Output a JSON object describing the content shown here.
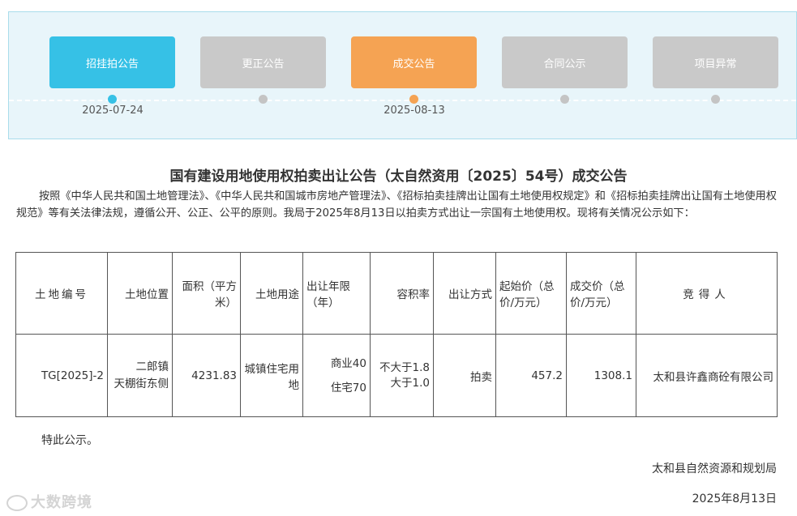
{
  "steps": [
    {
      "label": "招挂拍公告",
      "state": "done",
      "color": "#36c1e6",
      "date": "2025-07-24"
    },
    {
      "label": "更正公告",
      "state": "inactive",
      "color": "#c9c9c9",
      "date": ""
    },
    {
      "label": "成交公告",
      "state": "current",
      "color": "#f5a353",
      "date": "2025-08-13"
    },
    {
      "label": "合同公示",
      "state": "inactive",
      "color": "#c9c9c9",
      "date": ""
    },
    {
      "label": "项目异常",
      "state": "inactive",
      "color": "#c9c9c9",
      "date": ""
    }
  ],
  "title": "国有建设用地使用权拍卖出让公告（太自然资用〔2025〕54号）成交公告",
  "intro": "按照《中华人民共和国土地管理法》、《中华人民共和国城市房地产管理法》、《招标拍卖挂牌出让国有土地使用权规定》和《招标拍卖挂牌出让国有土地使用权规范》等有关法律法规，遵循公开、公正、公平的原则。我局于2025年8月13日以拍卖方式出让一宗国有土地使用权。现将有关情况公示如下：",
  "table": {
    "headers": {
      "parcel_no": "土地编号",
      "location": "土地位置",
      "area": "面积（平方米）",
      "use": "土地用途",
      "term": "出让年限（年）",
      "far": "容积率",
      "method": "出让方式",
      "start_price": "起始价（总价/万元）",
      "deal_price": "成交价（总价/万元）",
      "winner": "竞得人"
    },
    "row": {
      "parcel_no": "TG[2025]-2",
      "location_1": "二郎镇",
      "location_2": "天棚街东侧",
      "area": "4231.83",
      "use": "城镇住宅用地",
      "term_1": "商业40",
      "term_2": "住宅70",
      "far_1": "不大于1.8",
      "far_2": "大于1.0",
      "method": "拍卖",
      "start_price": "457.2",
      "deal_price": "1308.1",
      "winner": "太和县许鑫商砼有限公司"
    }
  },
  "notice": "特此公示。",
  "org": "太和县自然资源和规划局",
  "date": "2025年8月13日",
  "watermark": "大数跨境"
}
